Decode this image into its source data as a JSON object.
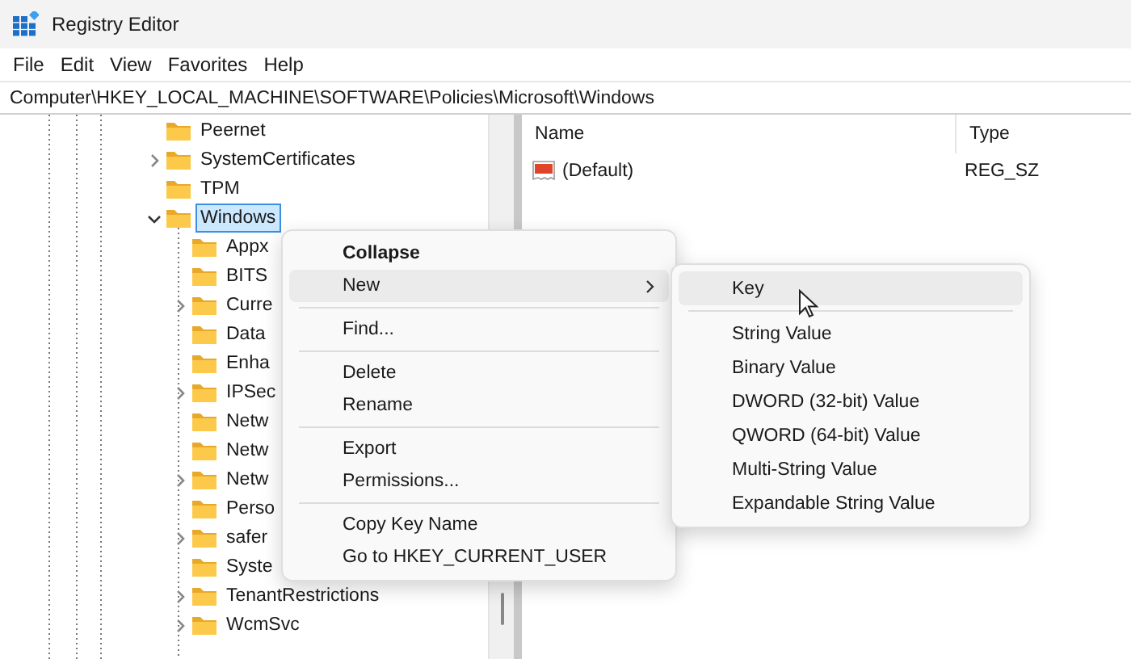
{
  "window": {
    "title": "Registry Editor"
  },
  "menu_bar": [
    "File",
    "Edit",
    "View",
    "Favorites",
    "Help"
  ],
  "address_bar": {
    "value": "Computer\\HKEY_LOCAL_MACHINE\\SOFTWARE\\Policies\\Microsoft\\Windows"
  },
  "tree": [
    {
      "label": "Peernet",
      "selected": false
    },
    {
      "label": "SystemCertificates",
      "expanded": false,
      "selected": false
    },
    {
      "label": "TPM",
      "selected": false
    },
    {
      "label": "Windows",
      "expanded": true,
      "selected": true,
      "children": [
        {
          "label": "Appx",
          "selected": false
        },
        {
          "label": "BITS",
          "selected": false
        },
        {
          "label": "Curre",
          "expanded": false,
          "selected": false
        },
        {
          "label": "Data",
          "selected": false
        },
        {
          "label": "Enha",
          "selected": false
        },
        {
          "label": "IPSec",
          "expanded": false,
          "selected": false
        },
        {
          "label": "Netw",
          "selected": false
        },
        {
          "label": "Netw",
          "selected": false
        },
        {
          "label": "Netw",
          "expanded": false,
          "selected": false
        },
        {
          "label": "Perso",
          "selected": false
        },
        {
          "label": "safer",
          "expanded": false,
          "selected": false
        },
        {
          "label": "Syste",
          "selected": false
        },
        {
          "label": "TenantRestrictions",
          "expanded": false,
          "selected": false
        },
        {
          "label": "WcmSvc",
          "expanded": false,
          "selected": false
        }
      ]
    }
  ],
  "values": {
    "columns": [
      "Name",
      "Type"
    ],
    "rows": [
      {
        "name": "(Default)",
        "type": "REG_SZ"
      }
    ]
  },
  "context_menu": {
    "groups": [
      [
        {
          "label": "Collapse",
          "default": true,
          "has_submenu": false,
          "selected": false
        },
        {
          "label": "New",
          "default": false,
          "has_submenu": true,
          "selected": true
        }
      ],
      [
        {
          "label": "Find...",
          "default": false,
          "has_submenu": false,
          "selected": false
        }
      ],
      [
        {
          "label": "Delete",
          "default": false,
          "has_submenu": false,
          "selected": false
        },
        {
          "label": "Rename",
          "default": false,
          "has_submenu": false,
          "selected": false
        }
      ],
      [
        {
          "label": "Export",
          "default": false,
          "has_submenu": false,
          "selected": false
        },
        {
          "label": "Permissions...",
          "default": false,
          "has_submenu": false,
          "selected": false
        }
      ],
      [
        {
          "label": "Copy Key Name",
          "default": false,
          "has_submenu": false,
          "selected": false
        },
        {
          "label": "Go to HKEY_CURRENT_USER",
          "default": false,
          "has_submenu": false,
          "selected": false
        }
      ]
    ]
  },
  "submenu": {
    "groups": [
      [
        {
          "label": "Key",
          "selected": true
        }
      ],
      [
        {
          "label": "String Value",
          "selected": false
        },
        {
          "label": "Binary Value",
          "selected": false
        },
        {
          "label": "DWORD (32-bit) Value",
          "selected": false
        },
        {
          "label": "QWORD (64-bit) Value",
          "selected": false
        },
        {
          "label": "Multi-String Value",
          "selected": false
        },
        {
          "label": "Expandable String Value",
          "selected": false
        }
      ]
    ]
  }
}
